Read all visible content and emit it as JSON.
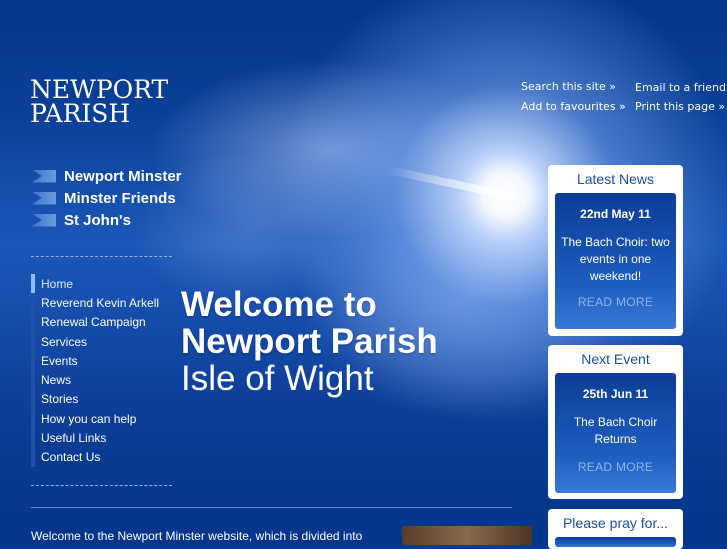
{
  "logo": {
    "line1": "NEWPORT",
    "line2": "PARISH"
  },
  "utility": {
    "search": "Search this site »",
    "email": "Email to a friend »",
    "favourites": "Add to favourites »",
    "print": "Print this page »"
  },
  "primary_nav": [
    {
      "label": "Newport Minster"
    },
    {
      "label": "Minster Friends"
    },
    {
      "label": "St John's"
    }
  ],
  "secondary_nav": [
    {
      "label": "Home",
      "active": true
    },
    {
      "label": "Reverend Kevin Arkell"
    },
    {
      "label": "Renewal Campaign"
    },
    {
      "label": "Services"
    },
    {
      "label": "Events"
    },
    {
      "label": "News"
    },
    {
      "label": "Stories"
    },
    {
      "label": "How you can help"
    },
    {
      "label": "Useful Links"
    },
    {
      "label": "Contact Us"
    }
  ],
  "hero": {
    "line1": "Welcome to",
    "line2": "Newport Parish",
    "line3": "Isle of Wight"
  },
  "intro_text": "Welcome to the Newport Minster website, which is divided into",
  "panels": {
    "news": {
      "title": "Latest News",
      "date": "22nd May 11",
      "text": "The Bach Choir: two events in one weekend!",
      "more": "READ MORE"
    },
    "event": {
      "title": "Next Event",
      "date": "25th Jun 11",
      "text": "The Bach Choir Returns",
      "more": "READ MORE"
    },
    "pray": {
      "title": "Please pray for..."
    }
  },
  "colors": {
    "background": "#06398f",
    "panel_title": "#1a4fa8",
    "read_more": "#8fb5ee"
  }
}
